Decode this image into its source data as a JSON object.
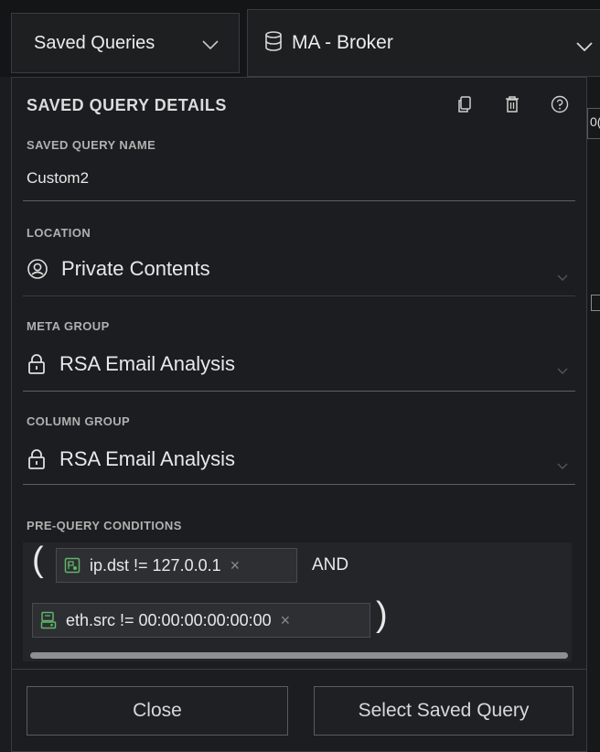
{
  "topbar": {
    "saved_queries_label": "Saved Queries",
    "service_label": "MA - Broker",
    "icons": [
      "chevron-down-icon",
      "database-icon"
    ]
  },
  "background_partial_text": "0(",
  "panel": {
    "title": "SAVED QUERY DETAILS",
    "header_icons": [
      "copy-icon",
      "trash-icon",
      "help-icon"
    ],
    "name": {
      "label": "SAVED QUERY NAME",
      "value": "Custom2"
    },
    "location": {
      "label": "LOCATION",
      "value": "Private Contents",
      "icon": "user-circle-icon"
    },
    "meta_group": {
      "label": "META GROUP",
      "value": "RSA Email Analysis",
      "icon": "lock-icon"
    },
    "column_group": {
      "label": "COLUMN GROUP",
      "value": "RSA Email Analysis",
      "icon": "lock-icon"
    },
    "pre_query": {
      "label": "PRE-QUERY CONDITIONS",
      "open_paren": "(",
      "close_paren": ")",
      "conditions": [
        {
          "text": "ip.dst != 127.0.0.1",
          "remove": "×",
          "icon": "meta-key-icon"
        },
        {
          "text": "eth.src != 00:00:00:00:00:00",
          "remove": "×",
          "icon": "meta-key-icon"
        }
      ],
      "operator": "AND"
    },
    "footer": {
      "close_label": "Close",
      "select_label": "Select Saved Query"
    }
  },
  "colors": {
    "background": "#1b1c1e",
    "panel": "#1c1d20",
    "pill_icon_green": "#5fb56a",
    "text": "#e6e6e6"
  }
}
